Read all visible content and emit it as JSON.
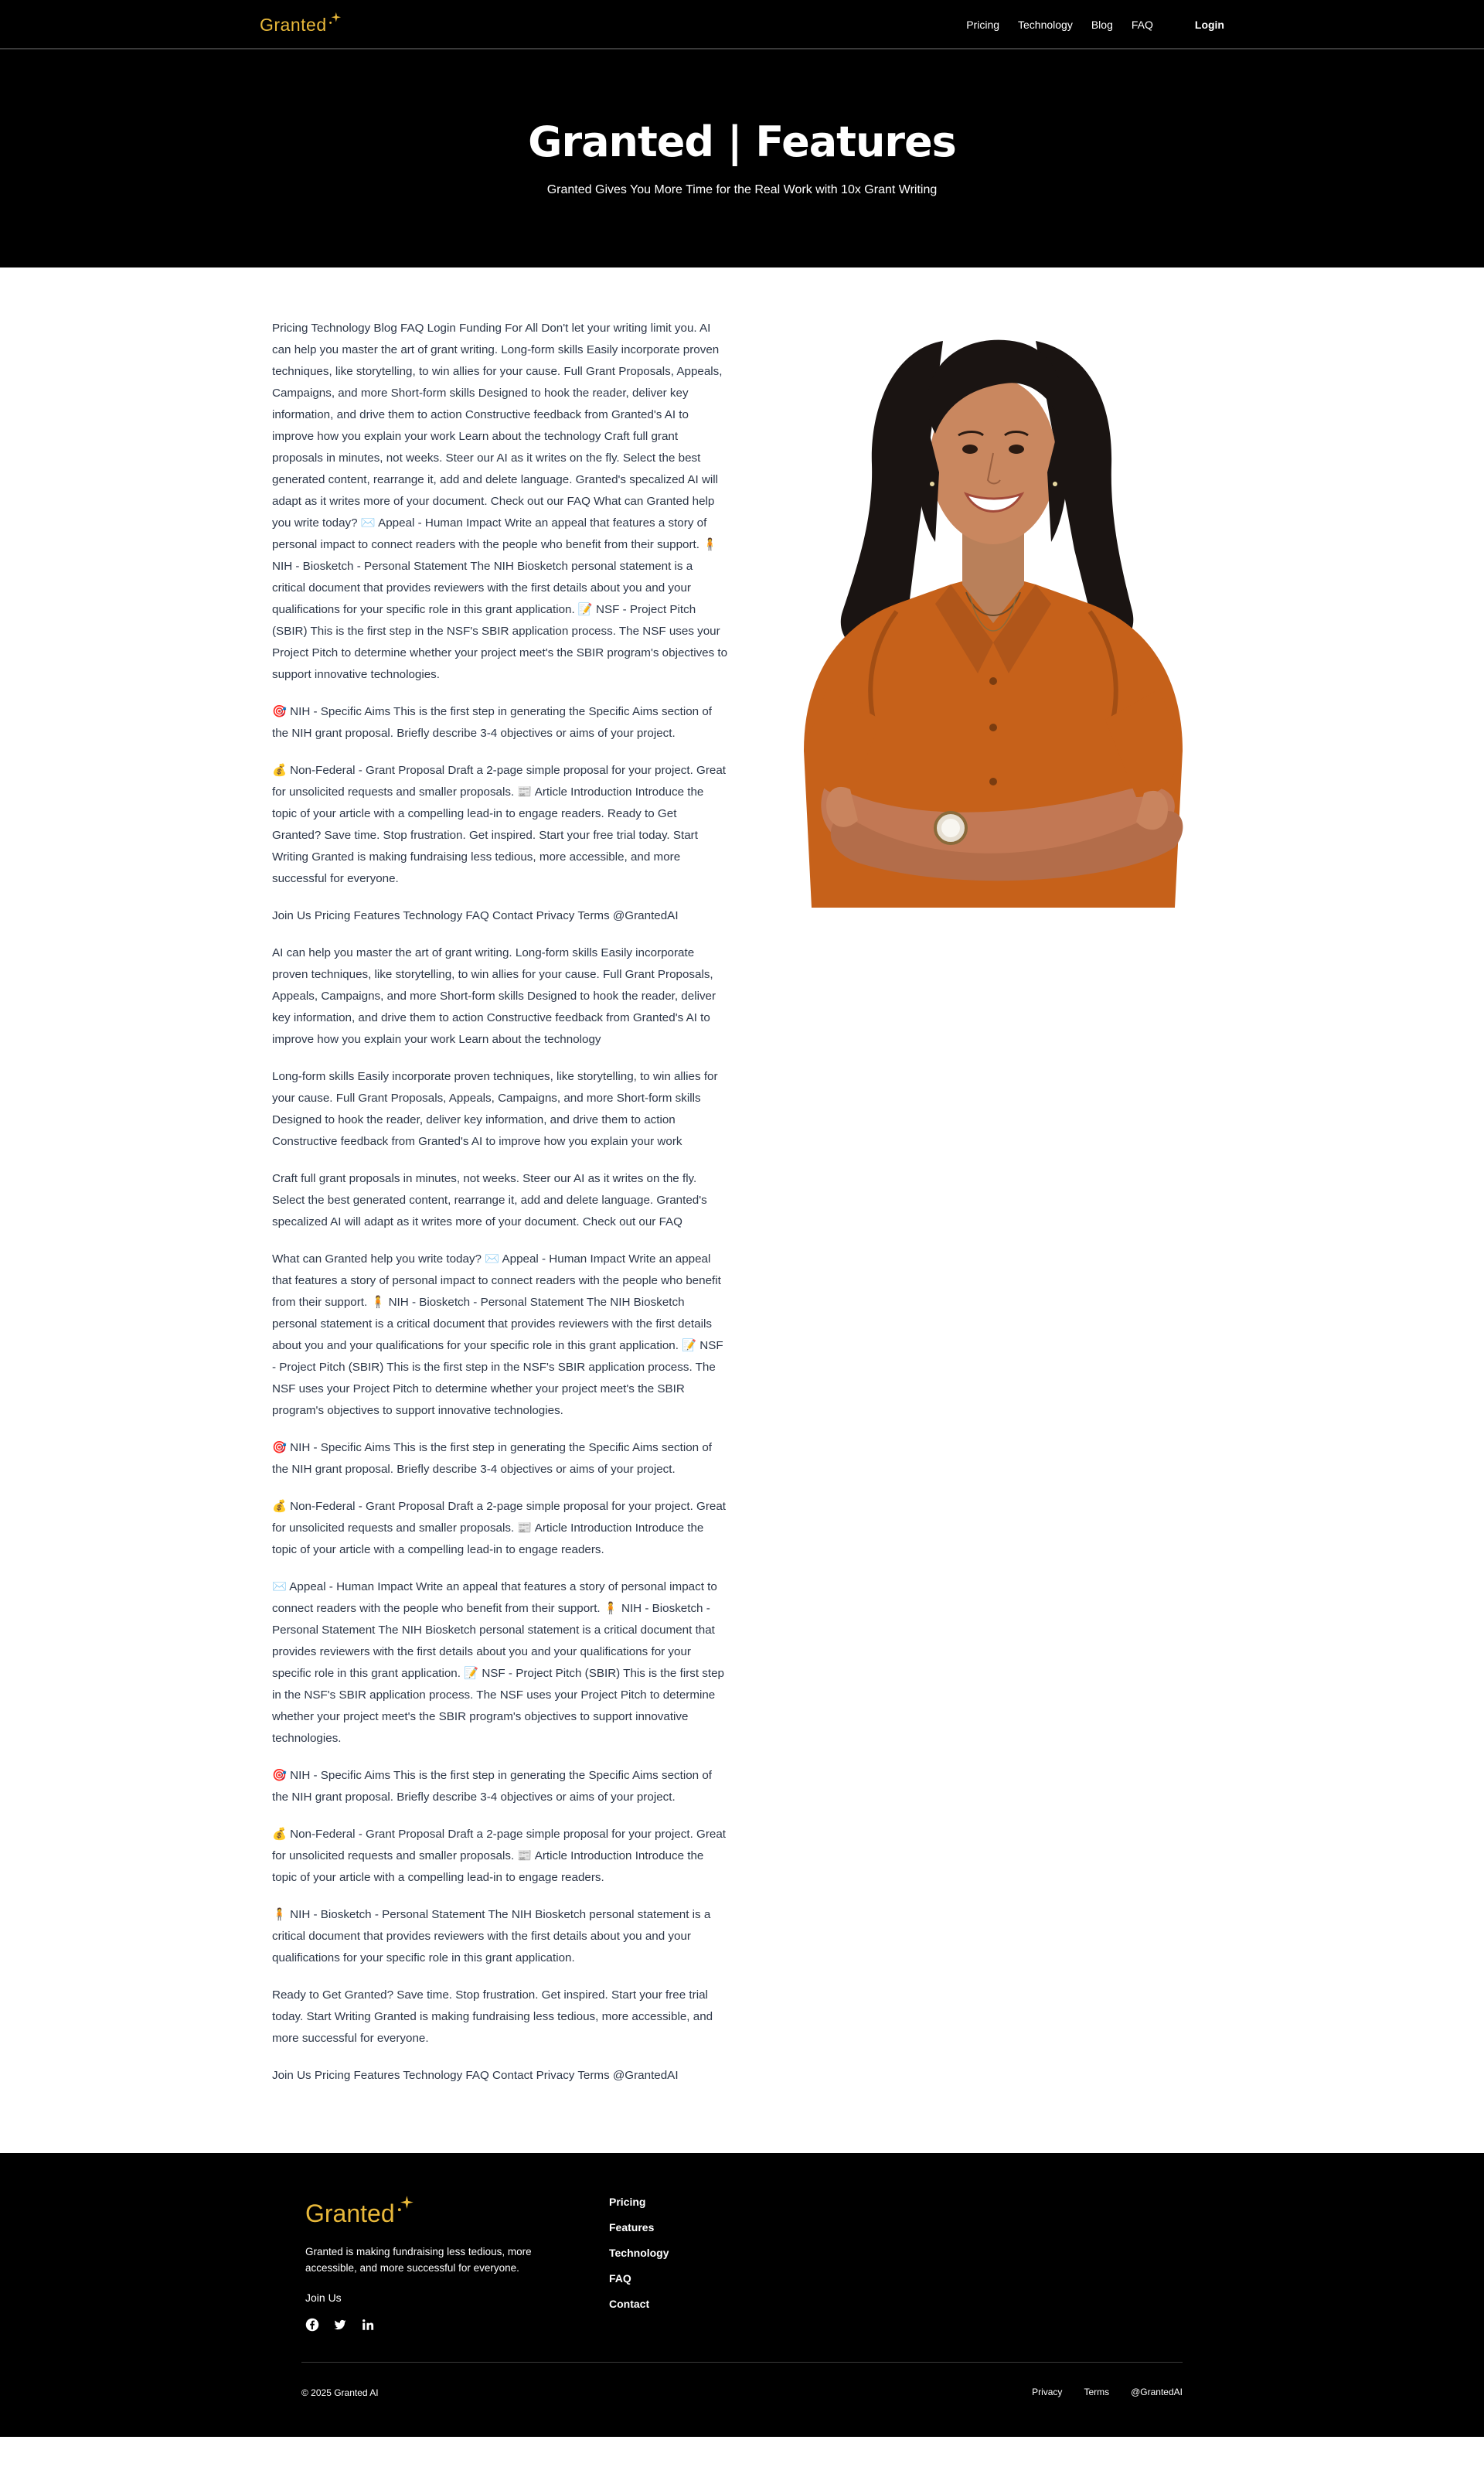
{
  "brand": {
    "name": "Granted",
    "accent_color": "#e8b83a"
  },
  "nav": {
    "links": [
      "Pricing",
      "Technology",
      "Blog",
      "FAQ"
    ],
    "login": "Login"
  },
  "hero": {
    "title": "Granted | Features",
    "subtitle": "Granted Gives You More Time for the Real Work with 10x Grant Writing"
  },
  "main": {
    "portrait_alt": "Smiling woman in orange shirt with crossed arms",
    "paragraphs": [
      "Pricing Technology Blog FAQ Login Funding For All Don't let your writing limit you. AI can help you master the art of grant writing. Long-form skills Easily incorporate proven techniques, like storytelling, to win allies for your cause. Full Grant Proposals, Appeals, Campaigns, and more Short-form skills Designed to hook the reader, deliver key information, and drive them to action Constructive feedback from Granted's AI to improve how you explain your work Learn about the technology Craft full grant proposals in minutes, not weeks. Steer our AI as it writes on the fly. Select the best generated content, rearrange it, add and delete language. Granted's specalized AI will adapt as it writes more of your document. Check out our FAQ What can Granted help you write today? ✉️ Appeal - Human Impact Write an appeal that features a story of personal impact to connect readers with the people who benefit from their support. 🧍 NIH - Biosketch - Personal Statement The NIH Biosketch personal statement is a critical document that provides reviewers with the first details about you and your qualifications for your specific role in this grant application. 📝 NSF - Project Pitch (SBIR) This is the first step in the NSF's SBIR application process. The NSF uses your Project Pitch to determine whether your project meet's the SBIR program's objectives to support innovative technologies.",
      "🎯 NIH - Specific Aims This is the first step in generating the Specific Aims section of the NIH grant proposal. Briefly describe 3-4 objectives or aims of your project.",
      "💰 Non-Federal - Grant Proposal Draft a 2-page simple proposal for your project. Great for unsolicited requests and smaller proposals. 📰 Article Introduction Introduce the topic of your article with a compelling lead-in to engage readers. Ready to Get Granted? Save time. Stop frustration. Get inspired. Start your free trial today. Start Writing Granted is making fundraising less tedious, more accessible, and more successful for everyone.",
      "Join Us Pricing Features Technology FAQ Contact Privacy Terms @GrantedAI",
      "AI can help you master the art of grant writing. Long-form skills Easily incorporate proven techniques, like storytelling, to win allies for your cause. Full Grant Proposals, Appeals, Campaigns, and more Short-form skills Designed to hook the reader, deliver key information, and drive them to action Constructive feedback from Granted's AI to improve how you explain your work Learn about the technology",
      "Long-form skills Easily incorporate proven techniques, like storytelling, to win allies for your cause. Full Grant Proposals, Appeals, Campaigns, and more Short-form skills Designed to hook the reader, deliver key information, and drive them to action Constructive feedback from Granted's AI to improve how you explain your work",
      "Craft full grant proposals in minutes, not weeks. Steer our AI as it writes on the fly. Select the best generated content, rearrange it, add and delete language. Granted's specalized AI will adapt as it writes more of your document. Check out our FAQ",
      "What can Granted help you write today? ✉️ Appeal - Human Impact Write an appeal that features a story of personal impact to connect readers with the people who benefit from their support. 🧍 NIH - Biosketch - Personal Statement The NIH Biosketch personal statement is a critical document that provides reviewers with the first details about you and your qualifications for your specific role in this grant application. 📝 NSF - Project Pitch (SBIR) This is the first step in the NSF's SBIR application process. The NSF uses your Project Pitch to determine whether your project meet's the SBIR program's objectives to support innovative technologies.",
      "🎯 NIH - Specific Aims This is the first step in generating the Specific Aims section of the NIH grant proposal. Briefly describe 3-4 objectives or aims of your project.",
      "💰 Non-Federal - Grant Proposal Draft a 2-page simple proposal for your project. Great for unsolicited requests and smaller proposals. 📰 Article Introduction Introduce the topic of your article with a compelling lead-in to engage readers.",
      "✉️ Appeal - Human Impact Write an appeal that features a story of personal impact to connect readers with the people who benefit from their support. 🧍 NIH - Biosketch - Personal Statement The NIH Biosketch personal statement is a critical document that provides reviewers with the first details about you and your qualifications for your specific role in this grant application. 📝 NSF - Project Pitch (SBIR) This is the first step in the NSF's SBIR application process. The NSF uses your Project Pitch to determine whether your project meet's the SBIR program's objectives to support innovative technologies.",
      "🎯 NIH - Specific Aims This is the first step in generating the Specific Aims section of the NIH grant proposal. Briefly describe 3-4 objectives or aims of your project.",
      "💰 Non-Federal - Grant Proposal Draft a 2-page simple proposal for your project. Great for unsolicited requests and smaller proposals. 📰 Article Introduction Introduce the topic of your article with a compelling lead-in to engage readers.",
      "🧍 NIH - Biosketch - Personal Statement The NIH Biosketch personal statement is a critical document that provides reviewers with the first details about you and your qualifications for your specific role in this grant application.",
      "Ready to Get Granted? Save time. Stop frustration. Get inspired. Start your free trial today. Start Writing Granted is making fundraising less tedious, more accessible, and more successful for everyone.",
      "Join Us Pricing Features Technology FAQ Contact Privacy Terms @GrantedAI"
    ]
  },
  "footer": {
    "description": "Granted is making fundraising less tedious, more accessible, and more successful for everyone.",
    "join_label": "Join Us",
    "social_icons": [
      "facebook-icon",
      "twitter-icon",
      "linkedin-icon"
    ],
    "links": [
      "Pricing",
      "Features",
      "Technology",
      "FAQ",
      "Contact"
    ],
    "copyright": "© 2025 Granted AI",
    "bottom_links": [
      "Privacy",
      "Terms",
      "@GrantedAI"
    ]
  }
}
